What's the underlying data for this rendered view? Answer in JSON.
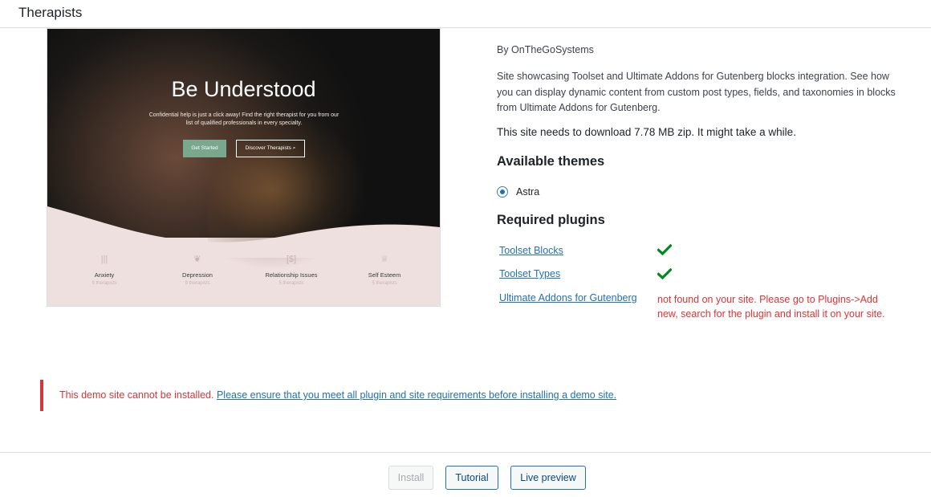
{
  "modal": {
    "title": "Therapists"
  },
  "preview": {
    "hero_title": "Be Understood",
    "hero_subtitle": "Confidential help is just a click away! Find the right therapist for you from our list of qualified professionals in every specialty.",
    "cta_primary": "Get Started",
    "cta_secondary": "Discover Therapists",
    "categories": [
      {
        "name": "Anxiety",
        "count": "9 therapists",
        "icon": "bars-icon"
      },
      {
        "name": "Depression",
        "count": "9 therapists",
        "icon": "brain-icon"
      },
      {
        "name": "Relationship Issues",
        "count": "5 therapists",
        "icon": "dollar-box-icon"
      },
      {
        "name": "Self Esteem",
        "count": "5 therapists",
        "icon": "crown-icon"
      }
    ]
  },
  "site": {
    "author": "By OnTheGoSystems",
    "description": "Site showcasing Toolset and Ultimate Addons for Gutenberg blocks integration. See how you can display dynamic content from custom post types, fields, and taxonomies in blocks from Ultimate Addons for Gutenberg.",
    "download_note": "This site needs to download 7.78 MB zip. It might take a while."
  },
  "themes": {
    "heading": "Available themes",
    "items": [
      {
        "name": "Astra",
        "selected": true
      }
    ]
  },
  "plugins": {
    "heading": "Required plugins",
    "items": [
      {
        "name": "Toolset Blocks",
        "status": "ok"
      },
      {
        "name": "Toolset Types",
        "status": "ok"
      },
      {
        "name": "Ultimate Addons for Gutenberg",
        "status": "missing",
        "message": "not found on your site. Please go to Plugins->Add new, search for the plugin and install it on your site."
      }
    ]
  },
  "notice": {
    "error_text": "This demo site cannot be installed.",
    "link_text": "Please ensure that you meet all plugin and site requirements before installing a demo site."
  },
  "footer": {
    "install_label": "Install",
    "tutorial_label": "Tutorial",
    "live_preview_label": "Live preview"
  },
  "colors": {
    "error": "#d63638",
    "link": "#2271b1",
    "check": "#008a20",
    "hero_button": "#7aa88f",
    "preview_bg": "#efe0e0"
  }
}
